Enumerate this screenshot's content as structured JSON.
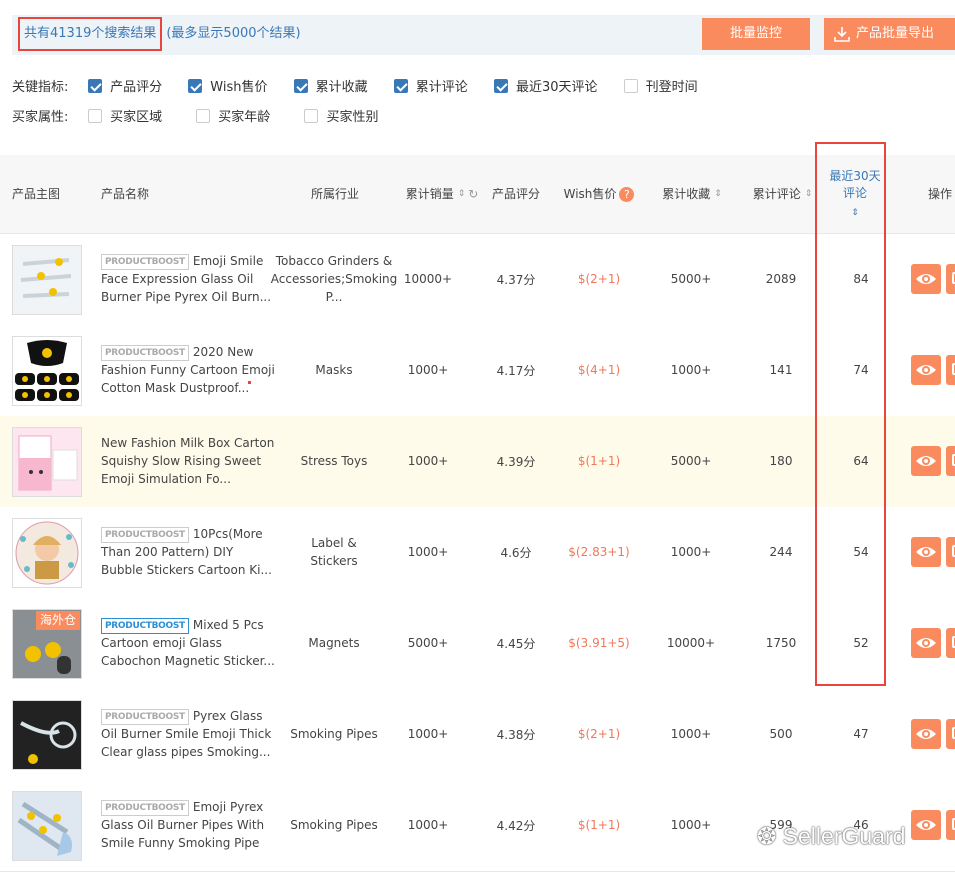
{
  "summary": {
    "count_text": "共有41319个搜索结果",
    "note_text": "(最多显示5000个结果)"
  },
  "actions": {
    "monitor_label": "批量监控",
    "export_label": "产品批量导出"
  },
  "filters": {
    "key_label": "关键指标:",
    "key_items": [
      {
        "label": "产品评分",
        "checked": true
      },
      {
        "label": "Wish售价",
        "checked": true
      },
      {
        "label": "累计收藏",
        "checked": true
      },
      {
        "label": "累计评论",
        "checked": true
      },
      {
        "label": "最近30天评论",
        "checked": true
      },
      {
        "label": "刊登时间",
        "checked": false
      }
    ],
    "buyer_label": "买家属性:",
    "buyer_items": [
      {
        "label": "买家区域",
        "checked": false
      },
      {
        "label": "买家年龄",
        "checked": false
      },
      {
        "label": "买家性别",
        "checked": false
      }
    ]
  },
  "table": {
    "headers": {
      "image": "产品主图",
      "name": "产品名称",
      "industry": "所属行业",
      "sales": "累计销量",
      "rating": "产品评分",
      "price": "Wish售价",
      "favorites": "累计收藏",
      "reviews": "累计评论",
      "recent_reviews": "最近30天评论",
      "action": "操作"
    },
    "badge_text": "PRODUCTBOOST",
    "overseas_tag": "海外仓",
    "rows": [
      {
        "name": "Emoji Smile Face Expression Glass Oil Burner Pipe Pyrex Oil Burn...",
        "badge": "gray",
        "industry": "Tobacco Grinders & Accessories;Smoking P...",
        "sales": "10000+",
        "rating": "4.37分",
        "price": "$(2+1)",
        "favorites": "5000+",
        "reviews": "2089",
        "recent": "84"
      },
      {
        "name": "2020 New Fashion Funny Cartoon Emoji Cotton Mask Dustproof...",
        "badge": "gray",
        "industry": "Masks",
        "sales": "1000+",
        "rating": "4.17分",
        "price": "$(4+1)",
        "favorites": "1000+",
        "reviews": "141",
        "recent": "74"
      },
      {
        "name": "New Fashion Milk Box Carton Squishy Slow Rising Sweet Emoji Simulation Fo...",
        "badge": "",
        "industry": "Stress Toys",
        "sales": "1000+",
        "rating": "4.39分",
        "price": "$(1+1)",
        "favorites": "5000+",
        "reviews": "180",
        "recent": "64"
      },
      {
        "name": "10Pcs(More Than 200 Pattern) DIY Bubble Stickers Cartoon Ki...",
        "badge": "gray",
        "industry": "Label & Stickers",
        "sales": "1000+",
        "rating": "4.6分",
        "price": "$(2.83+1)",
        "favorites": "1000+",
        "reviews": "244",
        "recent": "54"
      },
      {
        "name": "Mixed 5 Pcs Cartoon emoji Glass Cabochon Magnetic Sticker...",
        "badge": "blue",
        "industry": "Magnets",
        "sales": "5000+",
        "rating": "4.45分",
        "price": "$(3.91+5)",
        "favorites": "10000+",
        "reviews": "1750",
        "recent": "52"
      },
      {
        "name": "Pyrex Glass Oil Burner Smile Emoji Thick Clear glass pipes Smoking...",
        "badge": "gray",
        "industry": "Smoking Pipes",
        "sales": "1000+",
        "rating": "4.38分",
        "price": "$(2+1)",
        "favorites": "1000+",
        "reviews": "500",
        "recent": "47"
      },
      {
        "name": "Emoji Pyrex Glass Oil Burner Pipes With Smile Funny Smoking Pipe",
        "badge": "gray",
        "industry": "Smoking Pipes",
        "sales": "1000+",
        "rating": "4.42分",
        "price": "$(1+1)",
        "favorites": "1000+",
        "reviews": "599",
        "recent": "46"
      }
    ]
  },
  "watermark": "SellerGuard",
  "colors": {
    "accent": "#f98b5f",
    "link": "#3a78b5",
    "highlight": "#e8463c",
    "price": "#f0785a"
  }
}
